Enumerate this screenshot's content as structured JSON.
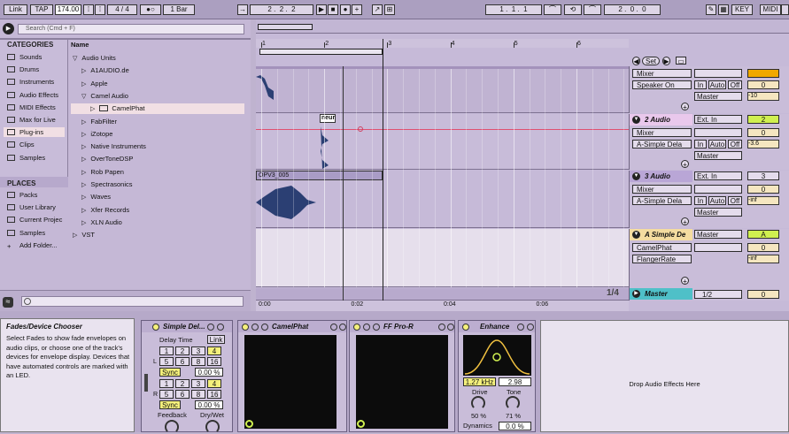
{
  "topbar": {
    "link": "Link",
    "tap": "TAP",
    "tempo": "174.00",
    "sig": "4 / 4",
    "quant": "1 Bar",
    "pos1": "2",
    "pos2": "2",
    "pos3": "2",
    "loop1": "1",
    "loop2": "1",
    "loop3": "1",
    "len1": "2",
    "len2": "0",
    "len3": "0",
    "key": "KEY",
    "midi": "MIDI"
  },
  "browser": {
    "search_placeholder": "Search (Cmd + F)",
    "categories_header": "CATEGORIES",
    "categories": [
      "Sounds",
      "Drums",
      "Instruments",
      "Audio Effects",
      "MIDI Effects",
      "Max for Live",
      "Plug-ins",
      "Clips",
      "Samples"
    ],
    "places_header": "PLACES",
    "places": [
      "Packs",
      "User Library",
      "Current Projec",
      "Samples",
      "Add Folder..."
    ],
    "name_header": "Name",
    "tree": [
      {
        "label": "Audio Units",
        "depth": 0,
        "arrow": "▽"
      },
      {
        "label": "A1AUDIO.de",
        "depth": 1,
        "arrow": "▷"
      },
      {
        "label": "Apple",
        "depth": 1,
        "arrow": "▷"
      },
      {
        "label": "Camel Audio",
        "depth": 1,
        "arrow": "▽"
      },
      {
        "label": "CamelPhat",
        "depth": 2,
        "arrow": "▷"
      },
      {
        "label": "FabFilter",
        "depth": 1,
        "arrow": "▷"
      },
      {
        "label": "iZotope",
        "depth": 1,
        "arrow": "▷"
      },
      {
        "label": "Native Instruments",
        "depth": 1,
        "arrow": "▷"
      },
      {
        "label": "OverToneDSP",
        "depth": 1,
        "arrow": "▷"
      },
      {
        "label": "Rob Papen",
        "depth": 1,
        "arrow": "▷"
      },
      {
        "label": "Spectrasonics",
        "depth": 1,
        "arrow": "▷"
      },
      {
        "label": "Waves",
        "depth": 1,
        "arrow": "▷"
      },
      {
        "label": "Xfer Records",
        "depth": 1,
        "arrow": "▷"
      },
      {
        "label": "XLN Audio",
        "depth": 1,
        "arrow": "▷"
      },
      {
        "label": "VST",
        "depth": 0,
        "arrow": "▷"
      }
    ]
  },
  "arrangement": {
    "ruler": [
      "1",
      "2",
      "3",
      "4",
      "5",
      "6"
    ],
    "time_ruler": [
      "0:00",
      "0:02",
      "0:04",
      "0:06"
    ],
    "clip2": "neur",
    "clip3": "OPV3_005",
    "page": "1/4",
    "set": "Set"
  },
  "tracks": {
    "t1": {
      "mixer": "Mixer",
      "sub": "Speaker On",
      "in": "In",
      "auto": "Auto",
      "off": "Off",
      "out": "Master",
      "vol": "0",
      "send": "-10"
    },
    "t2": {
      "name": "2 Audio",
      "input": "Ext. In",
      "num": "2",
      "mixer": "Mixer",
      "sub": "A-Simple Dela",
      "in": "In",
      "auto": "Auto",
      "off": "Off",
      "out": "Master",
      "vol": "0",
      "send": "-3.6"
    },
    "t3": {
      "name": "3 Audio",
      "input": "Ext. In",
      "num": "3",
      "mixer": "Mixer",
      "sub": "A-Simple Dela",
      "in": "In",
      "auto": "Auto",
      "off": "Off",
      "out": "Master",
      "vol": "0",
      "send": "-inf"
    },
    "tA": {
      "name": "A Simple De",
      "out": "Master",
      "letter": "A",
      "mixer": "CamelPhat",
      "sub": "FlangerRate",
      "vol": "0",
      "send": "-inf"
    },
    "master": {
      "name": "Master",
      "sel": "1/2",
      "vol": "0"
    }
  },
  "info": {
    "title": "Fades/Device Chooser",
    "body": "Select Fades to show fade envelopes on audio clips, or choose one of the track's devices for envelope display. Devices that have automated controls are marked with an LED."
  },
  "devices": {
    "simple": {
      "title": "Simple Del...",
      "delay_time": "Delay Time",
      "link": "Link",
      "row1": [
        "1",
        "2",
        "3",
        "4"
      ],
      "row2": [
        "5",
        "6",
        "8",
        "16"
      ],
      "sync": "Sync",
      "pct": "0.00 %",
      "L": "L",
      "R": "R",
      "feedback": "Feedback",
      "drywet": "Dry/Wet"
    },
    "camel": {
      "title": "CamelPhat"
    },
    "ffpro": {
      "title": "FF Pro-R"
    },
    "enhance": {
      "title": "Enhance",
      "freq": "1.27 kHz",
      "q": "2.98",
      "drive": "Drive",
      "drive_val": "50 %",
      "tone": "Tone",
      "tone_val": "71 %",
      "dynamics": "Dynamics",
      "dyn_val": "0.0 %"
    },
    "drop": "Drop Audio Effects Here"
  },
  "colors": {
    "accent_yellow": "#f4f07c",
    "track_orange": "#f0a800",
    "bg": "#bfb3cf",
    "lightpink": "#f1dfe4"
  }
}
